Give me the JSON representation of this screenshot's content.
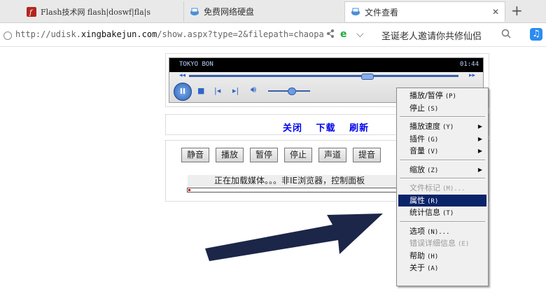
{
  "tabs": [
    {
      "label": "Flash技术网 flash|doswf|fla|s",
      "icon": "flash-icon"
    },
    {
      "label": "免费网络硬盘",
      "icon": "page-icon"
    },
    {
      "label": "文件查看",
      "icon": "page-icon"
    }
  ],
  "address": {
    "url_prefix": "http://udisk.",
    "url_domain": "xingbakejun.com",
    "url_rest": "/show.aspx?type=2&filepath=chaopa",
    "search_text": "圣诞老人邀请你共修仙侣"
  },
  "player": {
    "title": "TOKYO BON",
    "time": "01:44",
    "seek_fraction": 0.66,
    "volume_fraction": 0.55,
    "pause_symbol": "II"
  },
  "links": [
    "关闭",
    "下载",
    "刷新"
  ],
  "buttons": [
    "静音",
    "播放",
    "暂停",
    "停止",
    "声道",
    "提音"
  ],
  "status_text": "正在加载媒体。。。非IE浏览器，控制面板",
  "load_progress": 0.01,
  "context_menu": {
    "items": [
      {
        "label": "播放/暂停",
        "acc": "(P)",
        "submenu": false,
        "disabled": false,
        "selected": false
      },
      {
        "label": "停止",
        "acc": "(S)",
        "submenu": false,
        "disabled": false,
        "selected": false
      },
      {
        "label": "播放速度",
        "acc": "(Y)",
        "submenu": true,
        "disabled": false,
        "selected": false
      },
      {
        "label": "插件",
        "acc": "(G)",
        "submenu": true,
        "disabled": false,
        "selected": false
      },
      {
        "label": "音量",
        "acc": "(V)",
        "submenu": true,
        "disabled": false,
        "selected": false
      },
      {
        "label": "缩放",
        "acc": "(Z)",
        "submenu": true,
        "disabled": false,
        "selected": false
      },
      {
        "label": "文件标记",
        "acc": "(M)...",
        "submenu": false,
        "disabled": true,
        "selected": false
      },
      {
        "label": "属性",
        "acc": "(R)",
        "submenu": false,
        "disabled": false,
        "selected": true
      },
      {
        "label": "统计信息",
        "acc": "(T)",
        "submenu": false,
        "disabled": false,
        "selected": false
      },
      {
        "label": "选项",
        "acc": "(N)...",
        "submenu": false,
        "disabled": false,
        "selected": false
      },
      {
        "label": "错误详细信息",
        "acc": "(E)",
        "submenu": false,
        "disabled": true,
        "selected": false
      },
      {
        "label": "帮助",
        "acc": "(H)",
        "submenu": false,
        "disabled": false,
        "selected": false
      },
      {
        "label": "关于",
        "acc": "(A)",
        "submenu": false,
        "disabled": false,
        "selected": false
      }
    ]
  },
  "colors": {
    "menu_highlight": "#0a246a",
    "link": "#0000ee",
    "arrow": "#1c2649"
  }
}
